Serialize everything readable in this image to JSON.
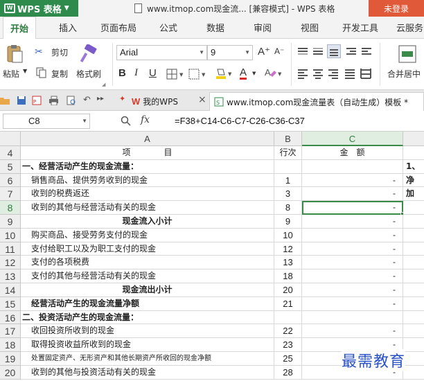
{
  "titlebar": {
    "app_name": "WPS 表格",
    "window_title": "www.itmop.com现金流... [兼容模式] - WPS 表格",
    "login_label": "未登录"
  },
  "menu": {
    "tabs": [
      "开始",
      "插入",
      "页面布局",
      "公式",
      "数据",
      "审阅",
      "视图",
      "开发工具",
      "云服务"
    ]
  },
  "ribbon": {
    "cut_label": "剪切",
    "copy_label": "复制",
    "paste_label": "粘贴",
    "format_painter_label": "格式刷",
    "font_name": "Arial",
    "font_size": "9",
    "bold": "B",
    "italic": "I",
    "underline": "U",
    "font_color_glyph": "A",
    "grow_font": "A⁺",
    "shrink_font": "A⁻",
    "merge_label": "合并居中"
  },
  "doc_tabs": [
    {
      "label": "我的WPS"
    },
    {
      "label": "www.itmop.com现金流量表（自动生成）模板 *"
    }
  ],
  "formula_bar": {
    "name_box": "C8",
    "fx": "fx",
    "formula": "=F38+C14-C6-C7-C26-C36-C37"
  },
  "columns": [
    "A",
    "B",
    "C"
  ],
  "rows": [
    {
      "num": "4",
      "a": "项　　　　目",
      "b": "行次",
      "c": "金　额",
      "d": "",
      "style": "header"
    },
    {
      "num": "5",
      "a": "一、经营活动产生的现金流量：",
      "b": "",
      "c": "",
      "d": "1、",
      "style": "bold"
    },
    {
      "num": "6",
      "a": "销售商品、提供劳务收到的现金",
      "b": "1",
      "c": "-",
      "d": "净",
      "style": ""
    },
    {
      "num": "7",
      "a": "收到的税费返还",
      "b": "3",
      "c": "-",
      "d": "加",
      "style": ""
    },
    {
      "num": "8",
      "a": "收到的其他与经营活动有关的现金",
      "b": "8",
      "c": "-",
      "d": "",
      "style": "selected"
    },
    {
      "num": "9",
      "a": "现金流入小计",
      "b": "9",
      "c": "-",
      "d": "",
      "style": "center"
    },
    {
      "num": "10",
      "a": "购买商品、接受劳务支付的现金",
      "b": "10",
      "c": "-",
      "d": "",
      "style": ""
    },
    {
      "num": "11",
      "a": "支付给职工以及为职工支付的现金",
      "b": "12",
      "c": "-",
      "d": "",
      "style": ""
    },
    {
      "num": "12",
      "a": "支付的各项税费",
      "b": "13",
      "c": "-",
      "d": "",
      "style": ""
    },
    {
      "num": "13",
      "a": "支付的其他与经营活动有关的现金",
      "b": "18",
      "c": "-",
      "d": "",
      "style": ""
    },
    {
      "num": "14",
      "a": "现金流出小计",
      "b": "20",
      "c": "-",
      "d": "",
      "style": "center"
    },
    {
      "num": "15",
      "a": "经营活动产生的现金流量净额",
      "b": "21",
      "c": "-",
      "d": "",
      "style": "bold-indent"
    },
    {
      "num": "16",
      "a": "二、投资活动产生的现金流量：",
      "b": "",
      "c": "",
      "d": "",
      "style": "bold"
    },
    {
      "num": "17",
      "a": "收回投资所收到的现金",
      "b": "22",
      "c": "-",
      "d": "",
      "style": ""
    },
    {
      "num": "18",
      "a": "取得投资收益所收到的现金",
      "b": "23",
      "c": "-",
      "d": "",
      "style": ""
    },
    {
      "num": "19",
      "a": "处置固定资产、无形资产和其他长期资产所收回的现金净额",
      "b": "25",
      "c": "-",
      "d": "",
      "style": "small"
    },
    {
      "num": "20",
      "a": "收到的其他与投资活动有关的现金",
      "b": "28",
      "c": "-",
      "d": "",
      "style": ""
    }
  ],
  "watermark": "最需教育"
}
